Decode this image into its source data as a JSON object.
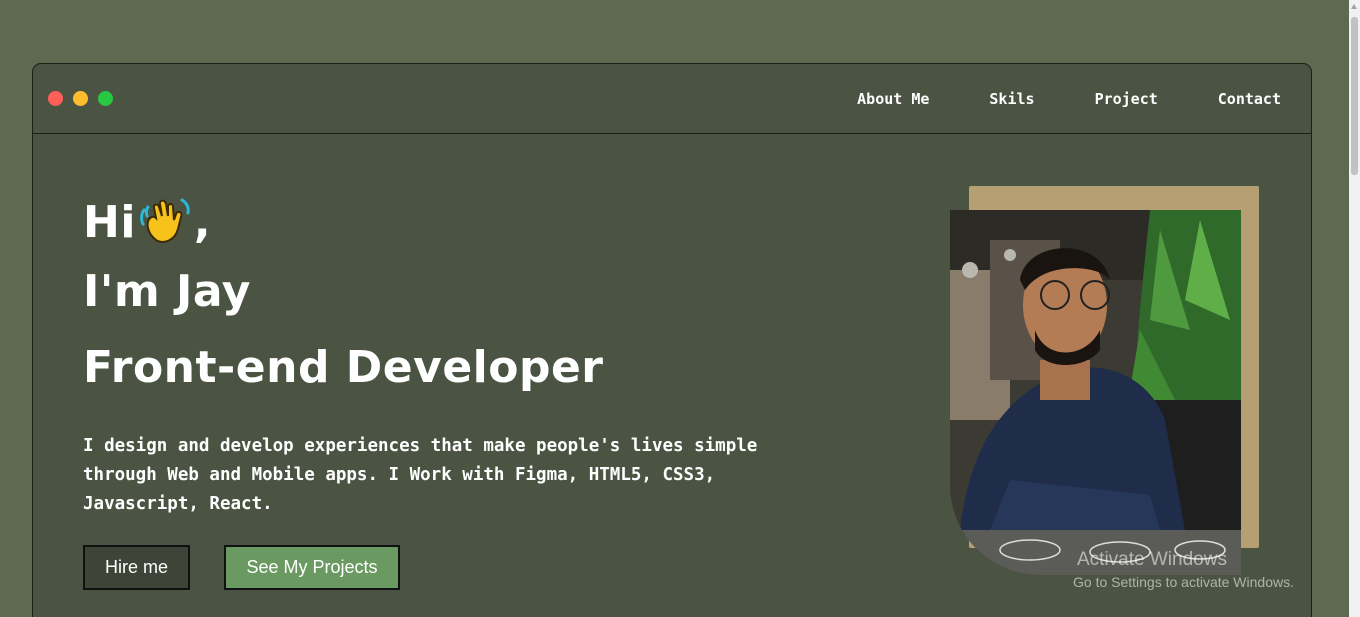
{
  "nav": {
    "items": [
      {
        "label": "About Me"
      },
      {
        "label": "Skils"
      },
      {
        "label": "Project"
      },
      {
        "label": "Contact"
      }
    ]
  },
  "hero": {
    "greeting": "Hi",
    "greeting_suffix": ",",
    "wave_icon": "waving-hand-icon",
    "name_line": "I'm Jay",
    "role_line": "Front-end Developer",
    "description": "I design and develop experiences that make people's lives simple through Web and Mobile apps. I Work with Figma, HTML5, CSS3, Javascript, React.",
    "hire_button": "Hire me",
    "projects_button": "See My Projects"
  },
  "watermark": {
    "line1": "Activate Windows",
    "line2": "Go to Settings to activate Windows."
  },
  "colors": {
    "page_bg": "#5e6952",
    "window_bg": "#4b5443",
    "accent_green": "#6a9a62",
    "photo_frame": "#b59f73"
  }
}
